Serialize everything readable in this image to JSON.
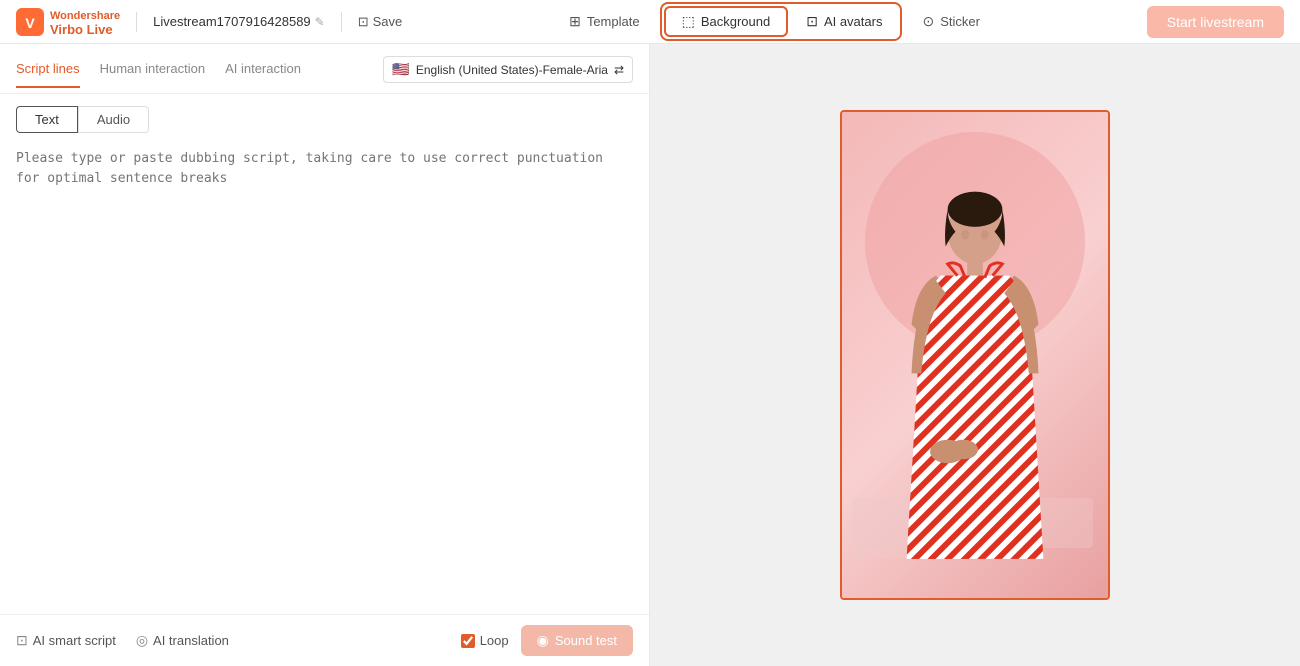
{
  "app": {
    "logo_text": "Virbo Live",
    "livestream_title": "Livestream1707916428589",
    "save_label": "Save"
  },
  "header": {
    "template_label": "Template",
    "background_label": "Background",
    "ai_avatars_label": "AI avatars",
    "sticker_label": "Sticker",
    "start_label": "Start livestream"
  },
  "left_panel": {
    "script_lines_label": "Script lines",
    "human_interaction_label": "Human interaction",
    "ai_interaction_label": "AI interaction",
    "voice_selector_label": "English (United States)-Female-Aria",
    "text_tab_label": "Text",
    "audio_tab_label": "Audio",
    "script_placeholder": "Please type or paste dubbing script, taking care to use correct punctuation for optimal sentence breaks",
    "ai_smart_script_label": "AI smart script",
    "ai_translation_label": "AI translation",
    "loop_label": "Loop",
    "sound_test_label": "Sound test"
  },
  "icons": {
    "edit": "✎",
    "save": "⊡",
    "template": "⊞",
    "background": "⬚",
    "ai_avatars": "⊡",
    "sticker": "⊙",
    "flag": "🇺🇸",
    "arrows": "⇄",
    "ai_script": "⊡",
    "ai_trans": "◎",
    "sound": "◉",
    "check": "✓"
  },
  "colors": {
    "accent": "#e05c2a",
    "accent_light": "#f4b8a8",
    "border": "#e8e8e8"
  }
}
